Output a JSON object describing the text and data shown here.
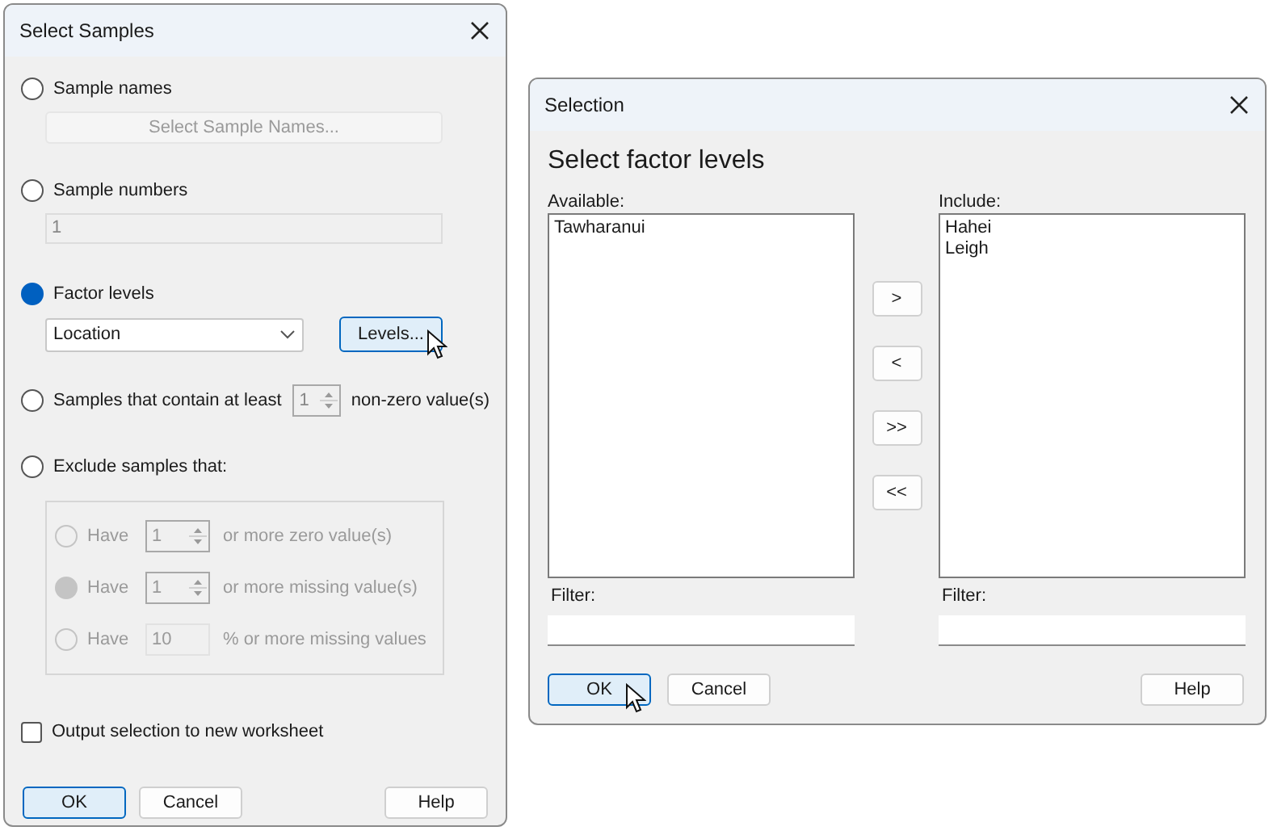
{
  "select_samples": {
    "title": "Select Samples",
    "options": [
      {
        "kind": "button",
        "label": "Sample names",
        "selected": false,
        "button": "Select Sample Names...",
        "disabled": true
      },
      {
        "kind": "field",
        "label": "Sample numbers",
        "selected": false,
        "value": "1",
        "disabled": true
      },
      {
        "kind": "dropdown",
        "label": "Factor levels",
        "selected": true,
        "value": "Location",
        "button": "Levels..."
      },
      {
        "kind": "spinner",
        "label": "Samples that contain at least",
        "selected": false,
        "value": "1",
        "suffix": "non-zero value(s)"
      },
      {
        "kind": "group",
        "label": "Exclude samples that:",
        "selected": false,
        "disabled": true,
        "rows": [
          {
            "kind": "spinner",
            "label": "Have",
            "value": "1",
            "suffix": "or more zero value(s)",
            "selected": false
          },
          {
            "kind": "spinner",
            "label": "Have",
            "value": "1",
            "suffix": "or more missing value(s)",
            "selected": true
          },
          {
            "kind": "field",
            "label": "Have",
            "value": "10",
            "suffix": "% or more missing values",
            "selected": false
          }
        ]
      }
    ],
    "output_checkbox": {
      "label": "Output selection to new worksheet",
      "checked": false
    },
    "buttons": [
      {
        "label": "OK",
        "focused": true
      },
      {
        "label": "Cancel",
        "focused": false
      },
      {
        "label": "Help",
        "focused": false
      }
    ]
  },
  "selection": {
    "title": "Selection",
    "heading": "Select factor levels",
    "lists": [
      {
        "label": "Available:",
        "items": [
          "Tawharanui"
        ],
        "filter_label": "Filter:"
      },
      {
        "label": "Include:",
        "items": [
          "Hahei",
          "Leigh"
        ],
        "filter_label": "Filter:"
      }
    ],
    "move_buttons": [
      ">",
      "<",
      ">>",
      "<<"
    ],
    "buttons": [
      {
        "label": "OK",
        "focused": true
      },
      {
        "label": "Cancel",
        "focused": false
      },
      {
        "label": "Help",
        "focused": false
      }
    ]
  }
}
